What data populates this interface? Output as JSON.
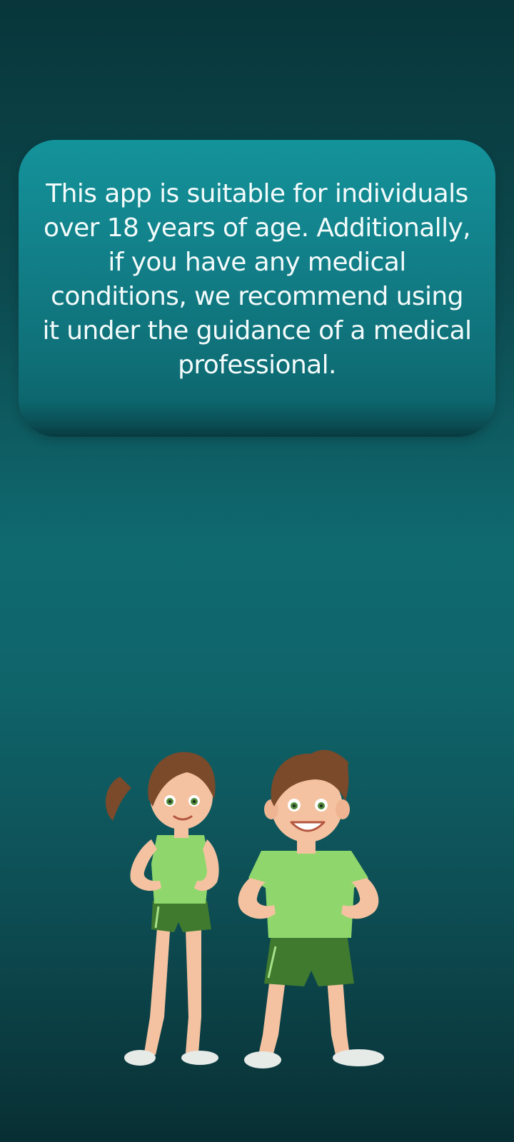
{
  "notice": {
    "text": "This app is suitable for individuals over 18 years of age. Additionally, if you have any medical conditions, we recommend using it under the guidance of a medical professional."
  },
  "illustration": {
    "icon": "fitness-couple-illustration",
    "colors": {
      "shirt": "#8fd76c",
      "shorts": "#3f7a2e",
      "skin": "#f4c2a0",
      "hair": "#7a4a2a",
      "shoes": "#e6ebe8"
    }
  }
}
